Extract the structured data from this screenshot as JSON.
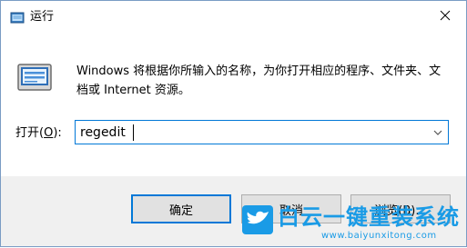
{
  "window": {
    "title": "运行",
    "close_symbol": "×"
  },
  "description": "Windows 将根据你所输入的名称，为你打开相应的程序、文件夹、文档或 Internet 资源。",
  "open_field": {
    "label_prefix": "打开(",
    "label_key": "O",
    "label_suffix": "):",
    "value": "regedit"
  },
  "buttons": {
    "ok": "确定",
    "cancel": "取消",
    "browse": "浏览(B)..."
  },
  "watermark": {
    "text": "白云一键重装系统",
    "url": "www.baiyunxitong.com"
  },
  "icons": {
    "title": "run-app-icon",
    "close": "close-icon",
    "run": "run-dialog-icon",
    "dropdown": "chevron-down-icon",
    "watermark": "bird-logo"
  },
  "colors": {
    "focus_border": "#0078d7",
    "footer_bg": "#f0f0f0",
    "watermark": "#1a9be6"
  }
}
